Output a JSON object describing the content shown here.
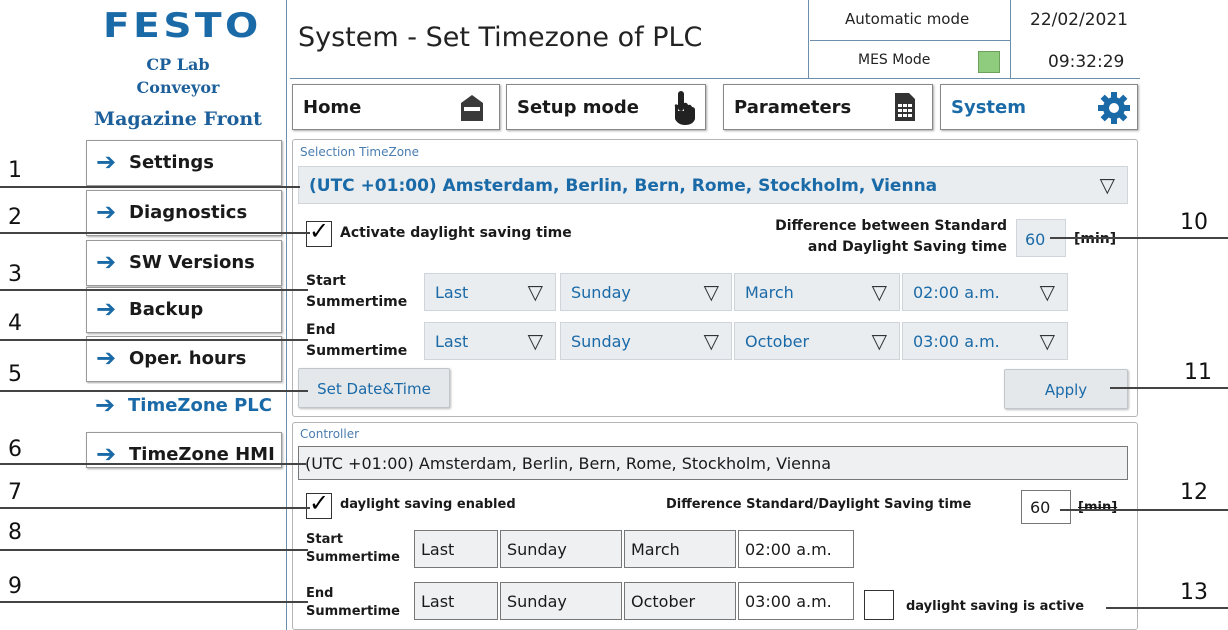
{
  "brand": {
    "logo": "FESTO",
    "line1": "CP Lab",
    "line2": "Conveyor",
    "line3": "Magazine Front"
  },
  "header": {
    "title": "System - Set Timezone of PLC",
    "mode": "Automatic mode",
    "mes_mode": "MES Mode",
    "mes_status_color": "#8fcc7e",
    "date": "22/02/2021",
    "time": "09:32:29"
  },
  "nav": {
    "home": "Home",
    "setup": "Setup mode",
    "parameters": "Parameters",
    "system": "System"
  },
  "sidebar": {
    "items": [
      {
        "label": "Settings"
      },
      {
        "label": "Diagnostics"
      },
      {
        "label": "SW Versions"
      },
      {
        "label": "Backup"
      },
      {
        "label": "Oper. hours"
      },
      {
        "label": "TimeZone PLC"
      },
      {
        "label": "TimeZone HMI"
      }
    ]
  },
  "selection": {
    "title": "Selection TimeZone",
    "timezone": "(UTC +01:00) Amsterdam, Berlin, Bern, Rome, Stockholm, Vienna",
    "dst_label": "Activate daylight saving time",
    "diff_label_1": "Difference between Standard",
    "diff_label_2": "and Daylight Saving time",
    "diff_value": "60",
    "unit": "[min]",
    "start_label_1": "Start",
    "start_label_2": "Summertime",
    "start": {
      "week": "Last",
      "day": "Sunday",
      "month": "March",
      "time": "02:00 a.m."
    },
    "end_label_1": "End",
    "end_label_2": "Summertime",
    "end": {
      "week": "Last",
      "day": "Sunday",
      "month": "October",
      "time": "03:00 a.m."
    },
    "set_datetime": "Set Date&Time",
    "apply": "Apply"
  },
  "controller": {
    "title": "Controller",
    "timezone": "(UTC +01:00) Amsterdam, Berlin, Bern, Rome, Stockholm, Vienna",
    "dst_enabled_label": "daylight saving enabled",
    "diff_label": "Difference Standard/Daylight Saving time",
    "diff_value": "60",
    "unit": "[min]",
    "start_label_1": "Start",
    "start_label_2": "Summertime",
    "start": {
      "week": "Last",
      "day": "Sunday",
      "month": "March",
      "time": "02:00 a.m."
    },
    "end_label_1": "End",
    "end_label_2": "Summertime",
    "end": {
      "week": "Last",
      "day": "Sunday",
      "month": "October",
      "time": "03:00 a.m."
    },
    "dst_active_label": "daylight saving is active"
  },
  "callouts": [
    "1",
    "2",
    "3",
    "4",
    "5",
    "6",
    "7",
    "8",
    "9",
    "10",
    "11",
    "12",
    "13"
  ]
}
